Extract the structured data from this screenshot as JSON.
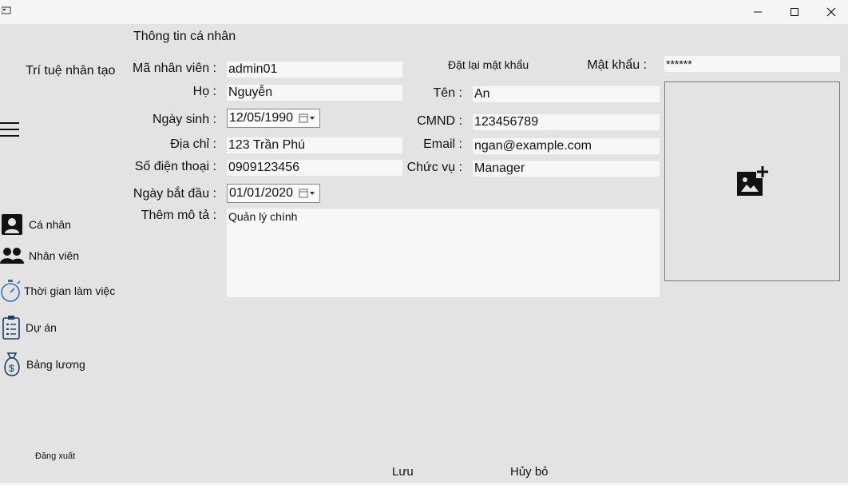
{
  "window": {
    "icon": "app-icon",
    "controls": [
      "minimize-icon",
      "maximize-icon",
      "close-icon"
    ]
  },
  "header": {
    "form_title": "Thông tin cá nhân",
    "company": "Trí tuệ nhân tạo"
  },
  "sidebar": {
    "items": [
      {
        "label": "Cá nhân",
        "icon": "person-icon"
      },
      {
        "label": "Nhân viên",
        "icon": "people-icon"
      },
      {
        "label": "Thời gian làm việc",
        "icon": "stopwatch-icon"
      },
      {
        "label": "Dự án",
        "icon": "clipboard-icon"
      },
      {
        "label": "Bảng lương",
        "icon": "money-bag-icon"
      }
    ],
    "logout": "Đăng xuất"
  },
  "form": {
    "employee_id": {
      "label": "Mã nhân viên :",
      "value": "admin01"
    },
    "last_name": {
      "label": "Họ :",
      "value": "Nguyễn"
    },
    "birth_date": {
      "label": "Ngày sinh :",
      "value": "12/05/1990"
    },
    "address": {
      "label": "Địa chỉ :",
      "value": "123 Trần Phú"
    },
    "phone": {
      "label": "Số điện thoại :",
      "value": "0909123456"
    },
    "start_date": {
      "label": "Ngày bắt đầu :",
      "value": "01/01/2020"
    },
    "description": {
      "label": "Thêm mô tả :",
      "value": "Quản lý chính"
    },
    "reset_password": "Đặt lại mật khẩu",
    "password": {
      "label": "Mật khẩu :",
      "value": "******"
    },
    "first_name": {
      "label": "Tên :",
      "value": "An"
    },
    "id_card": {
      "label": "CMND :",
      "value": "123456789"
    },
    "email": {
      "label": "Email :",
      "value": "ngan@example.com"
    },
    "position": {
      "label": "Chức vụ :",
      "value": "Manager"
    }
  },
  "actions": {
    "save": "Lưu",
    "cancel": "Hủy bỏ"
  },
  "colors": {
    "background": "#e3e3e3",
    "field_background": "#f7f7f7",
    "titlebar": "#f5f5f5"
  }
}
